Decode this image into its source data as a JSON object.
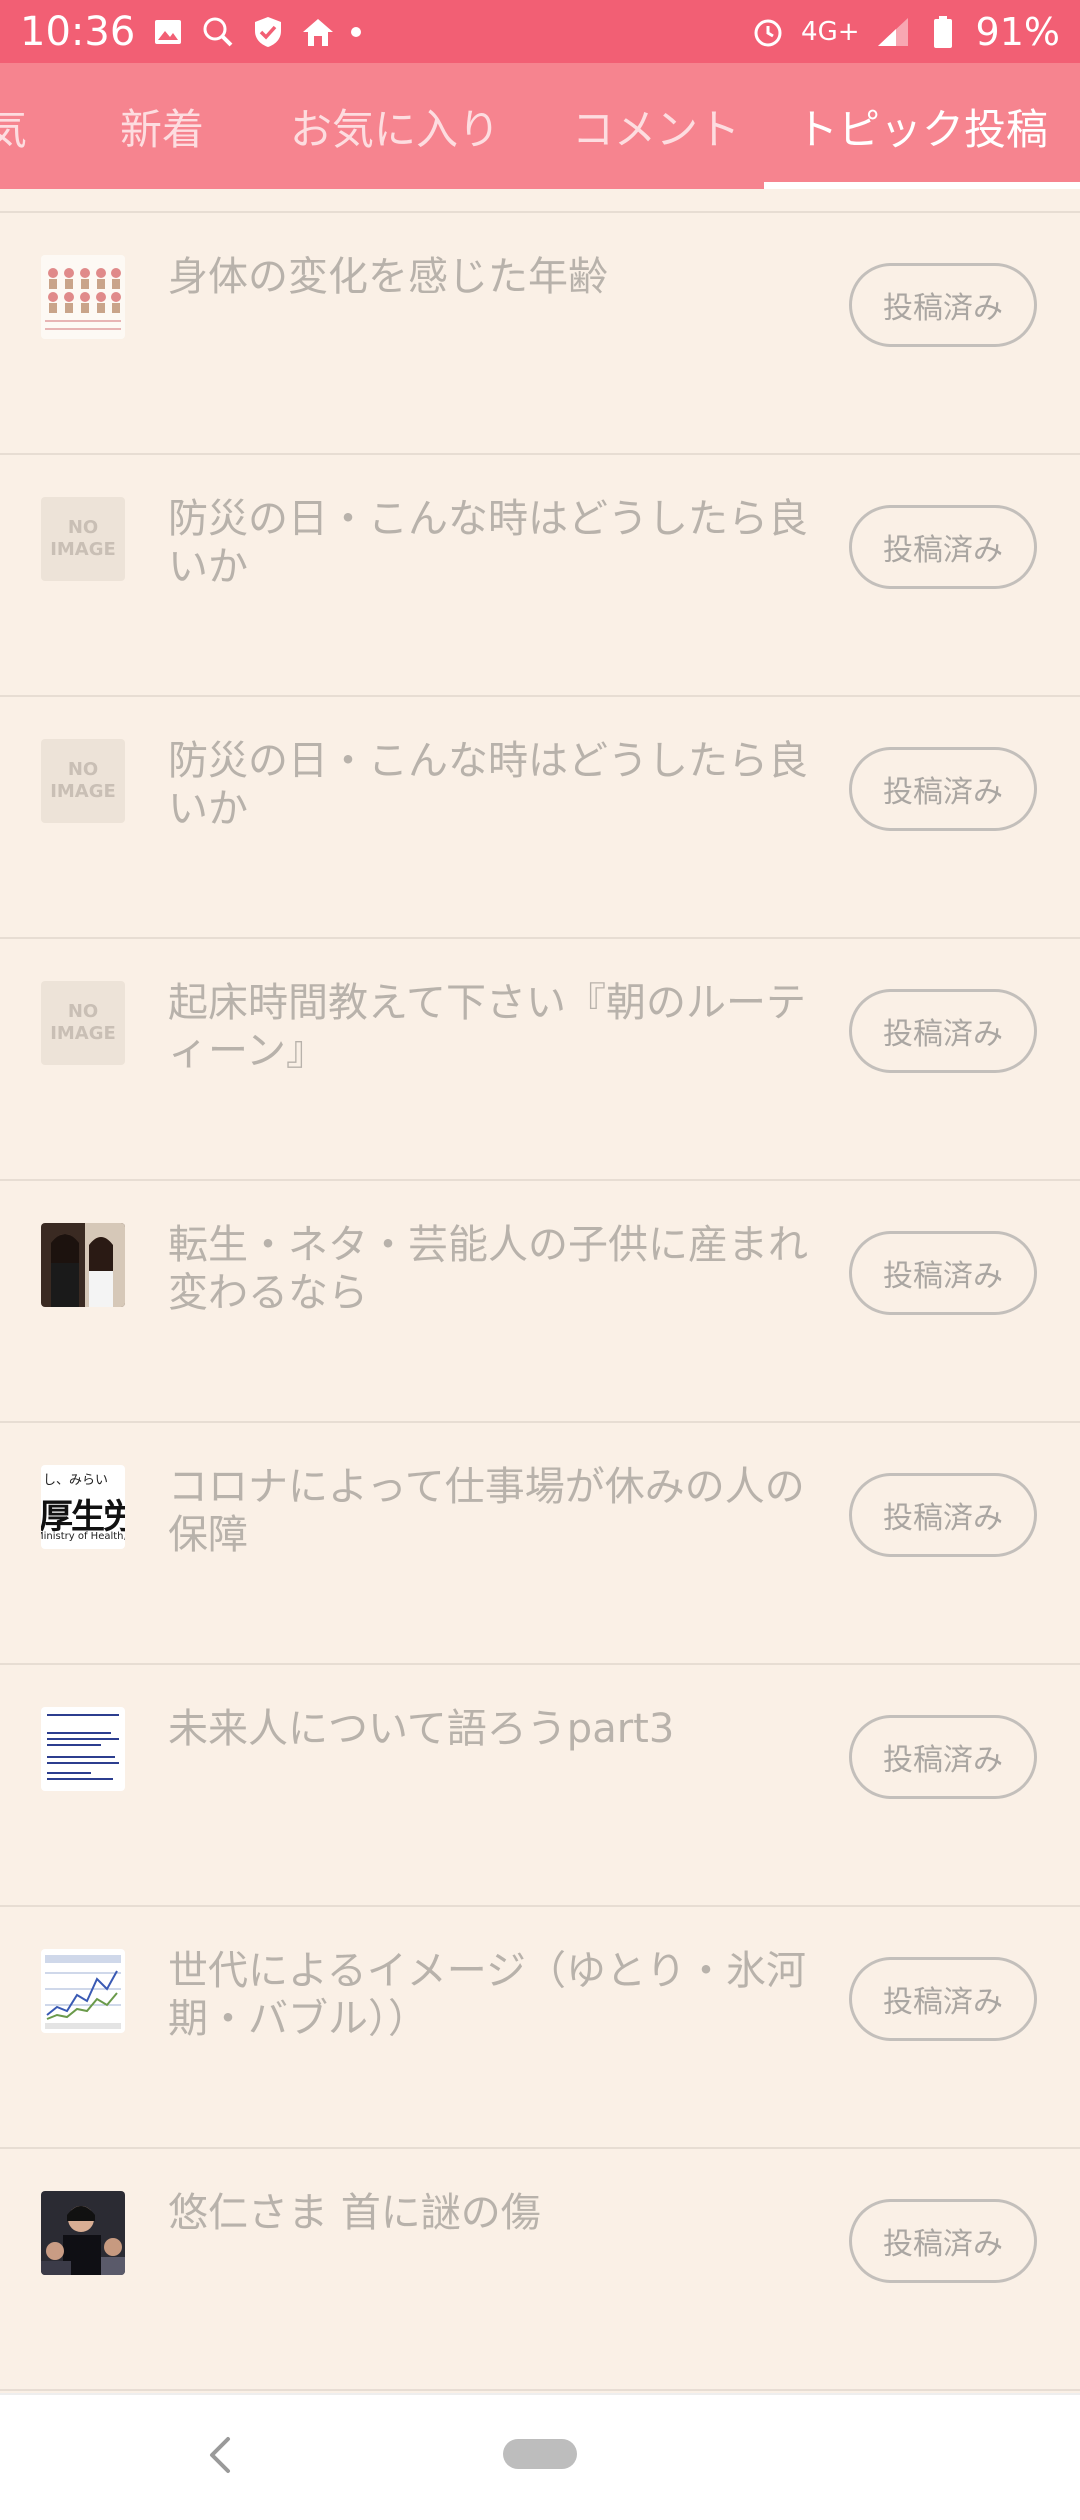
{
  "status_bar": {
    "time": "10:36",
    "network": "4G+",
    "battery": "91%"
  },
  "tabs": [
    {
      "label": "気"
    },
    {
      "label": "新着"
    },
    {
      "label": "お気に入り"
    },
    {
      "label": "コメント"
    },
    {
      "label": "トピック投稿"
    }
  ],
  "active_tab": "トピック投稿",
  "no_image": {
    "line1": "NO",
    "line2": "IMAGE"
  },
  "topics": [
    {
      "title": "身体の変化を感じた年齢",
      "button": "投稿済み"
    },
    {
      "title": "防災の日・こんな時はどうしたら良いか",
      "button": "投稿済み"
    },
    {
      "title": "防災の日・こんな時はどうしたら良いか",
      "button": "投稿済み"
    },
    {
      "title": "起床時間教えて下さい『朝のルーティーン』",
      "button": "投稿済み"
    },
    {
      "title": "転生・ネタ・芸能人の子供に産まれ変わるなら",
      "button": "投稿済み"
    },
    {
      "title": "コロナによって仕事場が休みの人の保障",
      "button": "投稿済み"
    },
    {
      "title": "未来人について語ろうpart3",
      "button": "投稿済み"
    },
    {
      "title": "世代によるイメージ（ゆとり・氷河期・バブル））",
      "button": "投稿済み"
    },
    {
      "title": "悠仁さま 首に謎の傷",
      "button": "投稿済み"
    }
  ],
  "thumb_texts": {
    "ministry_top": "し、みらい",
    "ministry_mid": "厚生労",
    "ministry_bottom": "Ministry of Health, Lab"
  },
  "colors": {
    "status_bar": "#f25f74",
    "tab_bar": "#f6848f",
    "background": "#faf0e6"
  }
}
